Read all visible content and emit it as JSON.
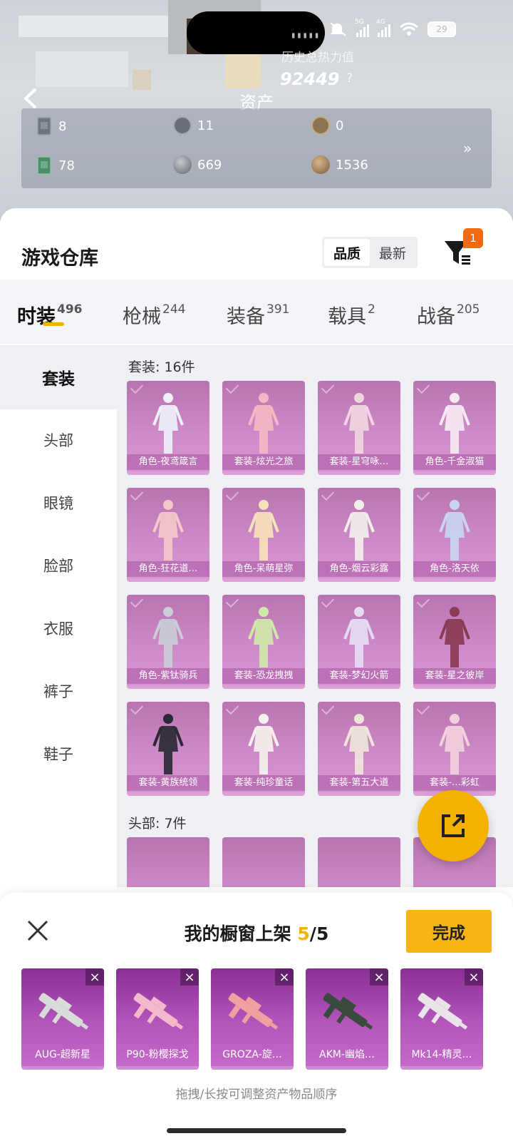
{
  "status_bar": {
    "battery": "29",
    "net1": "5G",
    "net2": "4G"
  },
  "header": {
    "title": "资产",
    "history_label": "历史总热力值",
    "history_value": "92449",
    "help": "?",
    "assets": [
      {
        "icon": "card-icon",
        "value": "8"
      },
      {
        "icon": "silver-coin-icon",
        "value": "11"
      },
      {
        "icon": "gold-coin-icon",
        "value": "0"
      },
      {
        "icon": "green-card-icon",
        "value": "78"
      },
      {
        "icon": "gray-orb-icon",
        "value": "669"
      },
      {
        "icon": "bronze-orb-icon",
        "value": "1536"
      }
    ],
    "expand": "»"
  },
  "warehouse": {
    "title": "游戏仓库",
    "sort_options": [
      "品质",
      "最新"
    ],
    "filter_badge": "1"
  },
  "tabs": [
    {
      "label": "时装",
      "count": "496"
    },
    {
      "label": "枪械",
      "count": "244"
    },
    {
      "label": "装备",
      "count": "391"
    },
    {
      "label": "载具",
      "count": "2"
    },
    {
      "label": "战备",
      "count": "205"
    }
  ],
  "sidebar": [
    "套装",
    "头部",
    "眼镜",
    "脸部",
    "衣服",
    "裤子",
    "鞋子"
  ],
  "sections": [
    {
      "title": "套装: 16件",
      "items": [
        "角色-夜鸢箴言",
        "套装-炫光之旅",
        "套装-星穹咏…",
        "角色-千金淑猫",
        "角色-狂花道…",
        "角色-呆萌星弥",
        "角色-烟云彩露",
        "角色-洛天依",
        "角色-紫钛骑兵",
        "套装-恐龙拽拽",
        "套装-梦幻火箭",
        "套装-星之彼岸",
        "套装-黄族统领",
        "套装-纯珍童话",
        "套装-第五大道",
        "套装-…彩虹"
      ]
    },
    {
      "title": "头部: 7件"
    }
  ],
  "shelf": {
    "title": "我的橱窗上架",
    "current": "5",
    "sep": "/",
    "total": "5",
    "done": "完成",
    "items": [
      "AUG-超新星",
      "P90-粉樱探戈",
      "GROZA-旋…",
      "AKM-幽焰…",
      "Mk14-精灵…"
    ],
    "hint": "拖拽/长按可调整资产物品顺序"
  }
}
